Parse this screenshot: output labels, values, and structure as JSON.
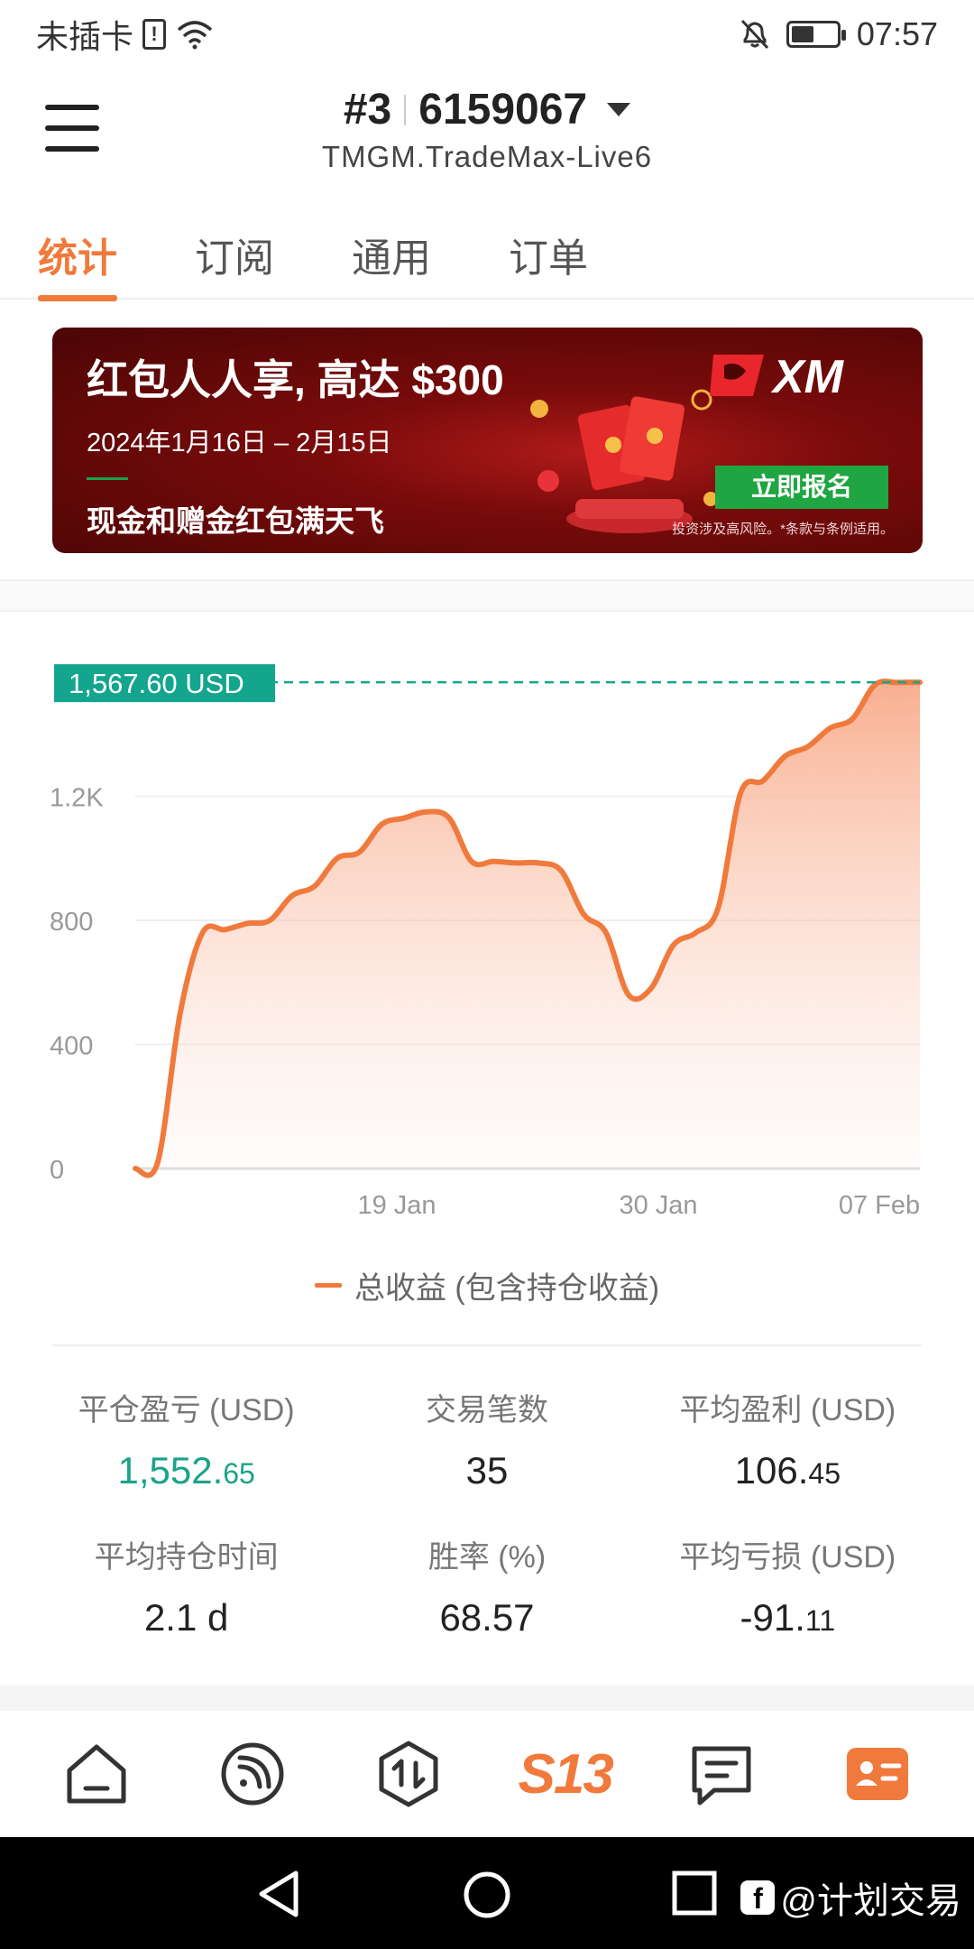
{
  "status_bar": {
    "carrier": "未插卡",
    "sim_glyph": "!",
    "time": "07:57"
  },
  "header": {
    "account_index": "#3",
    "account_number": "6159067",
    "server": "TMGM.TradeMax-Live6"
  },
  "tabs": [
    {
      "label": "统计",
      "active": true
    },
    {
      "label": "订阅",
      "active": false
    },
    {
      "label": "通用",
      "active": false
    },
    {
      "label": "订单",
      "active": false
    }
  ],
  "banner": {
    "title": "红包人人享, 高达 $300",
    "date": "2024年1月16日 – 2月15日",
    "subtitle": "现金和赠金红包满天飞",
    "brand": "XM",
    "button": "立即报名",
    "disclaimer": "投资涉及高风险。*条款与条例适用。"
  },
  "chart_data": {
    "type": "area",
    "current_label": "1,567.60 USD",
    "y_ticks": [
      "1.2K",
      "800",
      "400",
      "0"
    ],
    "x_ticks": [
      "19 Jan",
      "30 Jan",
      "07 Feb"
    ],
    "ylim": [
      0,
      1600
    ],
    "series": [
      {
        "name": "总收益 (包含持仓收益)",
        "color": "#f07a3c",
        "x": [
          0,
          1,
          2,
          3,
          4,
          5,
          6,
          7,
          8,
          9,
          10,
          11,
          12,
          13,
          14,
          15,
          16,
          17,
          18,
          19,
          20,
          21,
          22,
          23,
          24,
          25,
          26,
          27,
          28,
          29,
          30,
          31,
          32,
          33,
          34,
          35
        ],
        "values": [
          0,
          20,
          500,
          760,
          770,
          790,
          800,
          880,
          910,
          1000,
          1020,
          1110,
          1130,
          1150,
          1130,
          990,
          990,
          985,
          985,
          960,
          820,
          760,
          560,
          580,
          720,
          760,
          840,
          1210,
          1250,
          1330,
          1360,
          1420,
          1450,
          1560,
          1567,
          1567.6
        ]
      }
    ],
    "legend": "总收益 (包含持仓收益)"
  },
  "stats": [
    {
      "label": "平仓盈亏 (USD)",
      "int": "1,552.",
      "dec": "65",
      "style": "pos"
    },
    {
      "label": "交易笔数",
      "int": "35",
      "dec": "",
      "style": ""
    },
    {
      "label": "平均盈利 (USD)",
      "int": "106.",
      "dec": "45",
      "style": ""
    },
    {
      "label": "平均持仓时间",
      "int": "2.1 d",
      "dec": "",
      "style": ""
    },
    {
      "label": "胜率 (%)",
      "int": "68.57",
      "dec": "",
      "style": ""
    },
    {
      "label": "平均亏损 (USD)",
      "int": "-91.",
      "dec": "11",
      "style": ""
    }
  ],
  "bottom_nav": {
    "s13_label": "S13"
  },
  "watermark": "@计划交易",
  "colors": {
    "accent": "#f07a3c",
    "positive": "#1aa38a",
    "label_bg": "#13a58e"
  }
}
